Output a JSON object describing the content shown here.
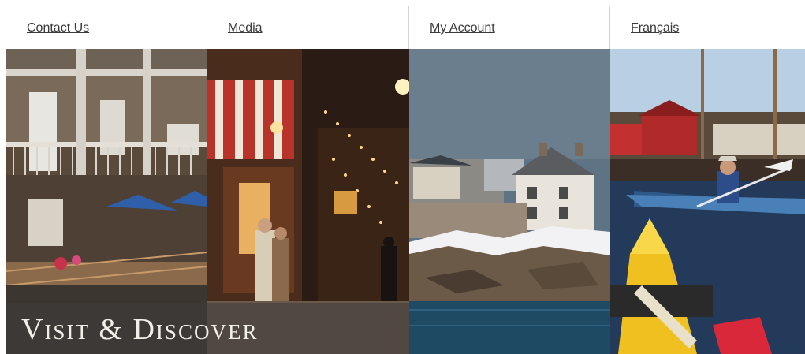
{
  "nav": {
    "items": [
      {
        "label": "Contact Us"
      },
      {
        "label": "Media"
      },
      {
        "label": "My Account"
      },
      {
        "label": "Français"
      }
    ]
  },
  "banner": {
    "caption": "Visit & Discover",
    "panels": [
      {
        "icon": "boardwalk-photo"
      },
      {
        "icon": "night-street-photo"
      },
      {
        "icon": "coastal-houses-photo"
      },
      {
        "icon": "kayak-harbour-photo"
      }
    ]
  },
  "colors": {
    "nav_text": "#3a3a3a",
    "separator": "#d4d4d4",
    "caption_text": "#f2efe8"
  }
}
